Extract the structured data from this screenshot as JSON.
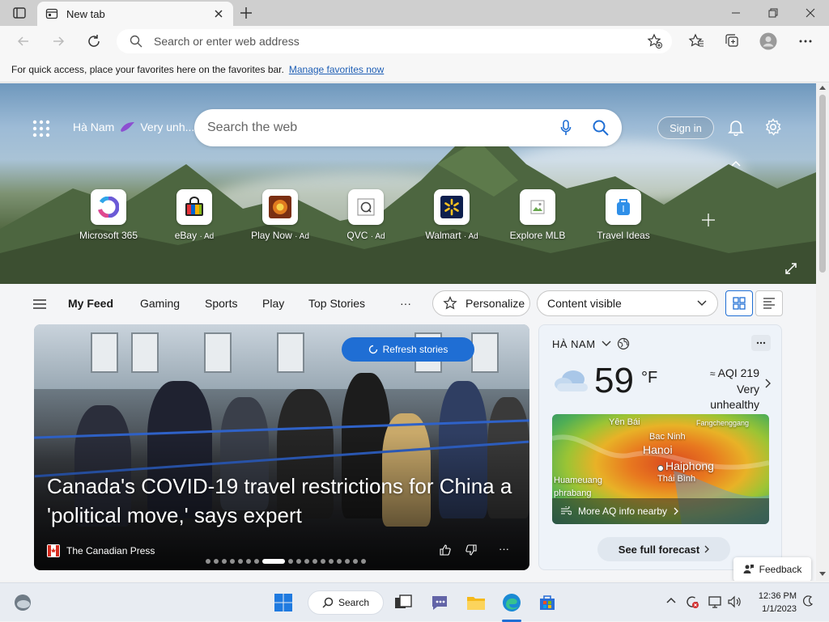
{
  "browser": {
    "tab_title": "New tab",
    "address_placeholder": "Search or enter web address",
    "favbar_text": "For quick access, place your favorites here on the favorites bar.",
    "favbar_link": "Manage favorites now"
  },
  "hero": {
    "location": "Hà Nam",
    "air_status_short": "Very unh...",
    "search_placeholder": "Search the web",
    "sign_in": "Sign in",
    "quick_links": [
      {
        "label": "Microsoft 365",
        "ad": ""
      },
      {
        "label": "eBay",
        "ad": "· Ad"
      },
      {
        "label": "Play Now",
        "ad": "· Ad"
      },
      {
        "label": "QVC",
        "ad": "· Ad"
      },
      {
        "label": "Walmart",
        "ad": "· Ad"
      },
      {
        "label": "Explore MLB",
        "ad": ""
      },
      {
        "label": "Travel Ideas",
        "ad": ""
      }
    ]
  },
  "feed_nav": {
    "tabs": [
      "My Feed",
      "Gaming",
      "Sports",
      "Play",
      "Top Stories"
    ],
    "more": "···",
    "personalize": "Personalize",
    "content_visibility": "Content visible"
  },
  "story": {
    "refresh": "Refresh stories",
    "headline": "Canada's COVID-19 travel restrictions for China a 'political move,' says expert",
    "source": "The Canadian Press",
    "more": "···"
  },
  "weather": {
    "location": "HÀ NAM",
    "temperature": "59",
    "unit": "°F",
    "aqi": "AQI 219",
    "aqi_status": "Very unhealthy",
    "map_labels": [
      "Yên Bái",
      "Bac Ninh",
      "Fangchenggang",
      "Hanoi",
      "Haiphong",
      "Thái Bình",
      "Huameuang",
      "phrabang"
    ],
    "aq_more": "More AQ info nearby",
    "forecast_button": "See full forecast"
  },
  "feedback": "Feedback",
  "taskbar": {
    "search": "Search",
    "time": "12:36 PM",
    "date": "1/1/2023"
  },
  "colors": {
    "accent": "#1f6ed4",
    "link": "#1f5fb5"
  }
}
